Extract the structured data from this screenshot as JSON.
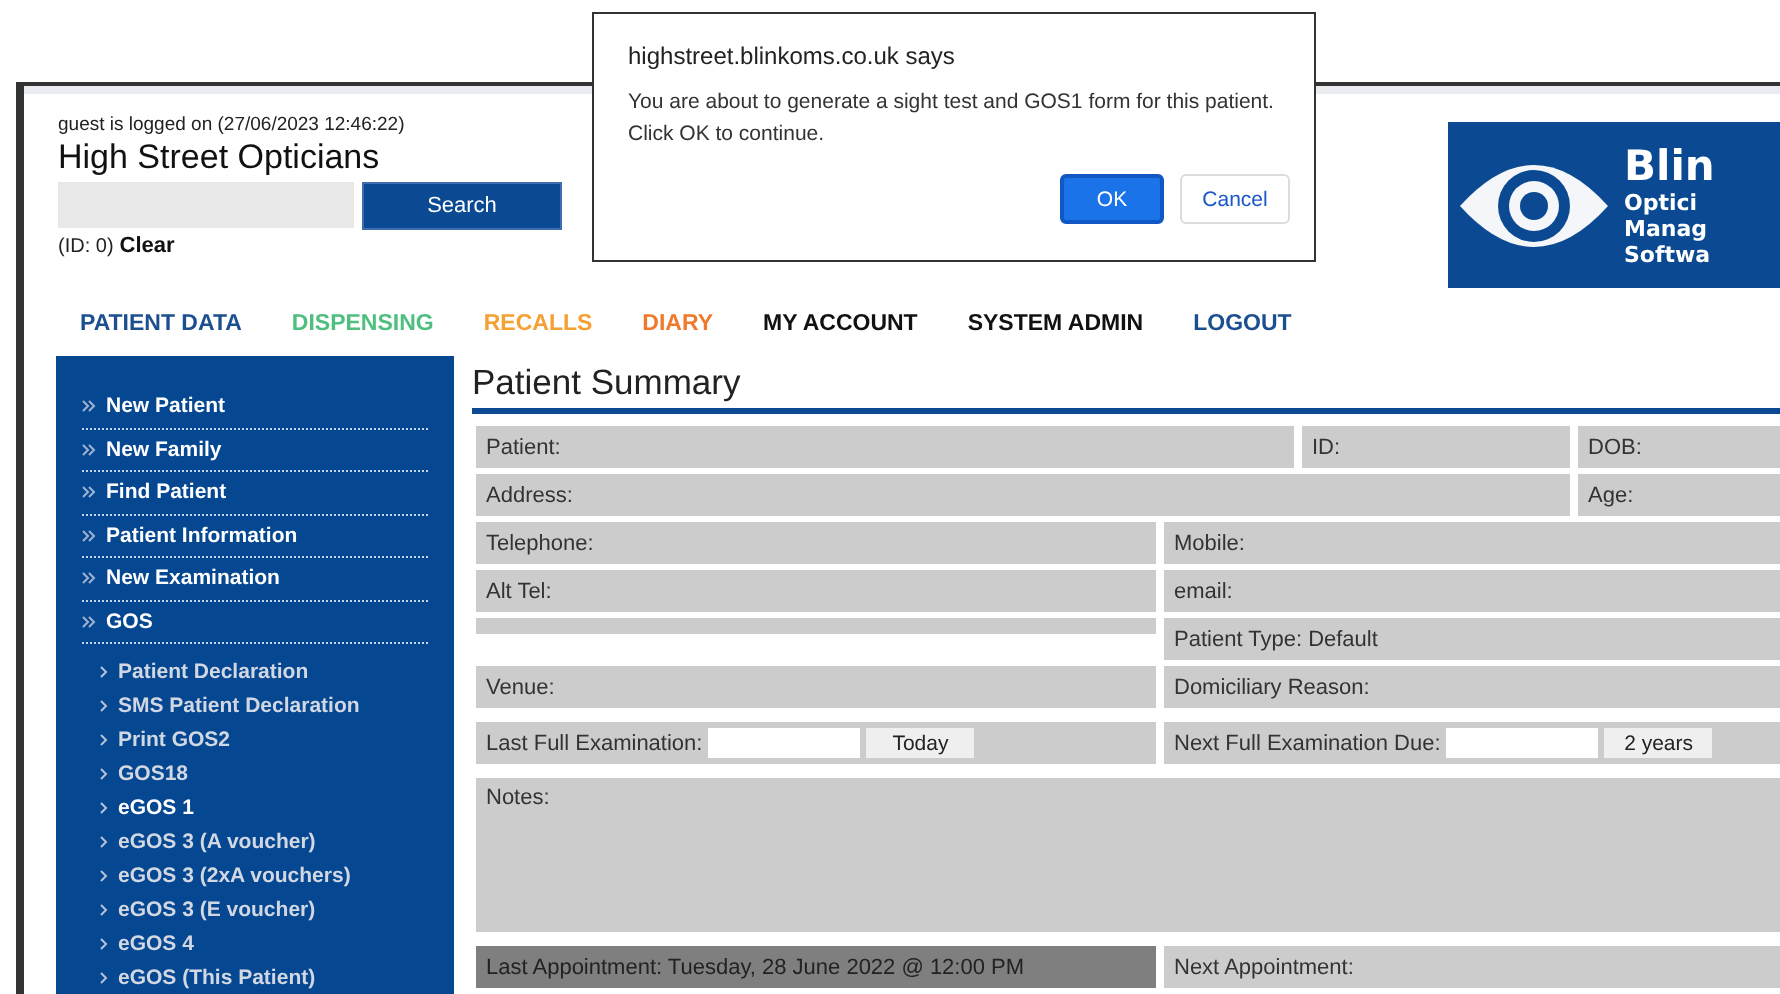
{
  "header": {
    "login_status": "guest is logged on (27/06/2023 12:46:22)",
    "practice_name": "High Street Opticians",
    "search": {
      "button": "Search"
    },
    "patient_id": "(ID: 0)",
    "clear_link": "Clear"
  },
  "logo": {
    "name": "Blin",
    "tagline": [
      "Optici",
      "Manag",
      "Softwa"
    ]
  },
  "nav": [
    {
      "label": "PATIENT DATA",
      "color": "#1c4f8f"
    },
    {
      "label": "DISPENSING",
      "color": "#4fbf7f"
    },
    {
      "label": "RECALLS",
      "color": "#f5a032"
    },
    {
      "label": "DIARY",
      "color": "#f07a2a"
    },
    {
      "label": "MY ACCOUNT",
      "color": "#111111"
    },
    {
      "label": "SYSTEM ADMIN",
      "color": "#111111"
    },
    {
      "label": "LOGOUT",
      "color": "#1c4f8f"
    }
  ],
  "sidebar": {
    "items": [
      {
        "label": "New Patient"
      },
      {
        "label": "New Family"
      },
      {
        "label": "Find Patient"
      },
      {
        "label": "Patient Information"
      },
      {
        "label": "New Examination"
      },
      {
        "label": "GOS",
        "children": [
          {
            "label": "Patient Declaration",
            "selected": false
          },
          {
            "label": "SMS Patient Declaration",
            "selected": false
          },
          {
            "label": "Print GOS2",
            "selected": false
          },
          {
            "label": "GOS18",
            "selected": false
          },
          {
            "label": "eGOS 1",
            "selected": true
          },
          {
            "label": "eGOS 3 (A voucher)",
            "selected": false
          },
          {
            "label": "eGOS 3 (2xA vouchers)",
            "selected": false
          },
          {
            "label": "eGOS 3 (E voucher)",
            "selected": false
          },
          {
            "label": "eGOS 4",
            "selected": false
          },
          {
            "label": "eGOS (This Patient)",
            "selected": false
          }
        ]
      }
    ]
  },
  "summary": {
    "title": "Patient Summary",
    "rows": [
      {
        "kind": "three",
        "cells": [
          {
            "kind": "text",
            "label": "Patient:"
          },
          {
            "kind": "text",
            "label": "ID:"
          },
          {
            "kind": "text",
            "label": "DOB:"
          }
        ]
      },
      {
        "kind": "wide",
        "cells": [
          {
            "kind": "text",
            "label": "Address:"
          },
          {
            "kind": "text",
            "label": "Age:"
          }
        ]
      },
      {
        "kind": "half",
        "cells": [
          {
            "kind": "text",
            "label": "Telephone:"
          },
          {
            "kind": "text",
            "label": "Mobile:"
          }
        ]
      },
      {
        "kind": "half",
        "cells": [
          {
            "kind": "text",
            "label": "Alt Tel:"
          },
          {
            "kind": "text",
            "label": "email:"
          }
        ]
      },
      {
        "kind": "half",
        "cells": [
          {
            "kind": "strip"
          },
          {
            "kind": "text",
            "label": "Patient Type: Default"
          }
        ]
      },
      {
        "kind": "half",
        "cells": [
          {
            "kind": "text",
            "label": "Venue:"
          },
          {
            "kind": "text",
            "label": "Domiciliary Reason:"
          }
        ]
      },
      {
        "kind": "half",
        "cells": [
          {
            "kind": "date",
            "label": "Last Full Examination:",
            "button": "Today"
          },
          {
            "kind": "date",
            "label": "Next Full Examination Due:",
            "button": "2 years"
          }
        ]
      },
      {
        "kind": "full",
        "cells": [
          {
            "kind": "notes",
            "label": "Notes:"
          }
        ]
      },
      {
        "kind": "half",
        "cells": [
          {
            "kind": "dark",
            "label": "Last Appointment: Tuesday, 28 June 2022 @ 12:00 PM"
          },
          {
            "kind": "text",
            "label": "Next Appointment:"
          }
        ]
      }
    ]
  },
  "dialog": {
    "title": "highstreet.blinkoms.co.uk says",
    "message": [
      "You are about to generate a sight test and GOS1 form for this patient.",
      "Click OK to continue."
    ],
    "buttons": [
      {
        "label": "OK",
        "kind": "primary"
      },
      {
        "label": "Cancel",
        "kind": "secondary"
      }
    ]
  }
}
